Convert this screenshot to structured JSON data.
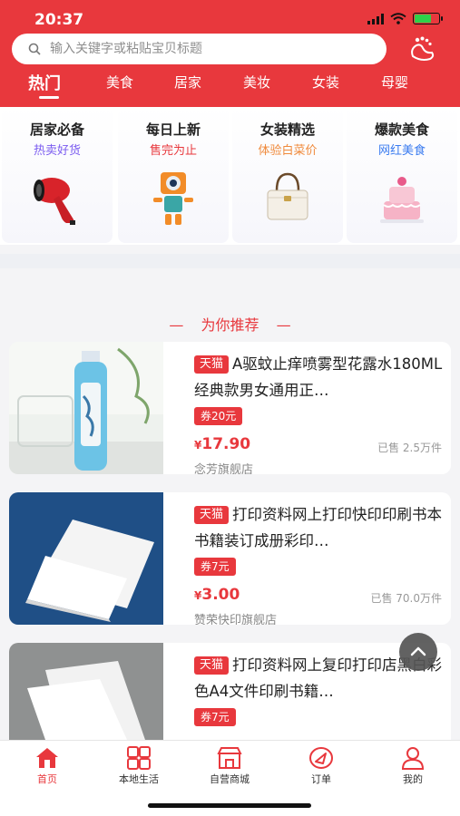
{
  "status": {
    "time": "20:37"
  },
  "search": {
    "placeholder": "输入关键字或粘贴宝贝标题"
  },
  "tabs": [
    "热门",
    "美食",
    "居家",
    "美妆",
    "女装",
    "母婴"
  ],
  "categories": [
    {
      "title": "居家必备",
      "subtitle": "热卖好货",
      "color": "#7a5bf0",
      "icon": "hair-dryer-icon"
    },
    {
      "title": "每日上新",
      "subtitle": "售完为止",
      "color": "#e8383d",
      "icon": "robot-toy-icon"
    },
    {
      "title": "女装精选",
      "subtitle": "体验白菜价",
      "color": "#f08a3c",
      "icon": "handbag-icon"
    },
    {
      "title": "爆款美食",
      "subtitle": "网红美食",
      "color": "#3b7cf0",
      "icon": "cake-icon"
    }
  ],
  "recommend": {
    "title": "为你推荐"
  },
  "products": [
    {
      "badge": "天猫",
      "title": "A驱蚊止痒喷雾型花露水180ML经典款男女通用正…",
      "coupon": "券20元",
      "price_symbol": "¥",
      "price": "17.90",
      "sold": "已售 2.5万件",
      "shop": "念芳旗舰店"
    },
    {
      "badge": "天猫",
      "title": "打印资料网上打印快印印刷书本书籍装订成册彩印…",
      "coupon": "券7元",
      "price_symbol": "¥",
      "price": "3.00",
      "sold": "已售 70.0万件",
      "shop": "赞荣快印旗舰店"
    },
    {
      "badge": "天猫",
      "title": "打印资料网上复印打印店黑白彩色A4文件印刷书籍…",
      "coupon": "券7元",
      "price_symbol": "¥",
      "price": "",
      "sold": "",
      "shop": ""
    }
  ],
  "bottom_nav": [
    {
      "label": "首页",
      "icon": "home-icon",
      "active": true
    },
    {
      "label": "本地生活",
      "icon": "grid-icon",
      "active": false
    },
    {
      "label": "自营商城",
      "icon": "store-icon",
      "active": false
    },
    {
      "label": "订单",
      "icon": "order-icon",
      "active": false
    },
    {
      "label": "我的",
      "icon": "profile-icon",
      "active": false
    }
  ],
  "colors": {
    "brand": "#e8383d"
  }
}
